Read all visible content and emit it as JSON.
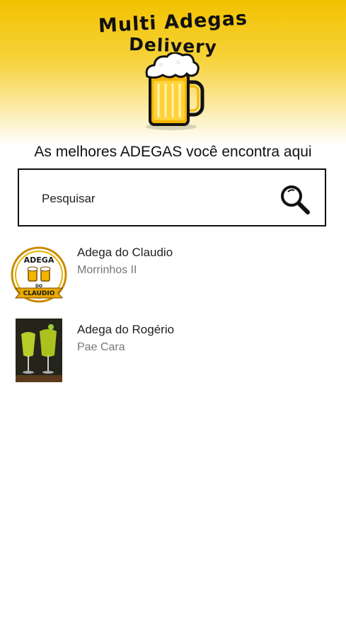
{
  "header": {
    "logo_line1": "Multi Adegas",
    "logo_line2": "Delivery",
    "tagline": "As melhores ADEGAS você encontra aqui"
  },
  "search": {
    "placeholder": "Pesquisar",
    "value": ""
  },
  "stores": [
    {
      "name": "Adega do Claudio",
      "location": "Morrinhos II",
      "logo_text_top": "ADEGA",
      "logo_text_mid": "DO",
      "logo_text_bottom": "CLAUDIO"
    },
    {
      "name": "Adega do Rogério",
      "location": "Pae Cara"
    }
  ],
  "colors": {
    "header_yellow": "#f2c200",
    "text_dark": "#222222",
    "text_muted": "#777777"
  }
}
